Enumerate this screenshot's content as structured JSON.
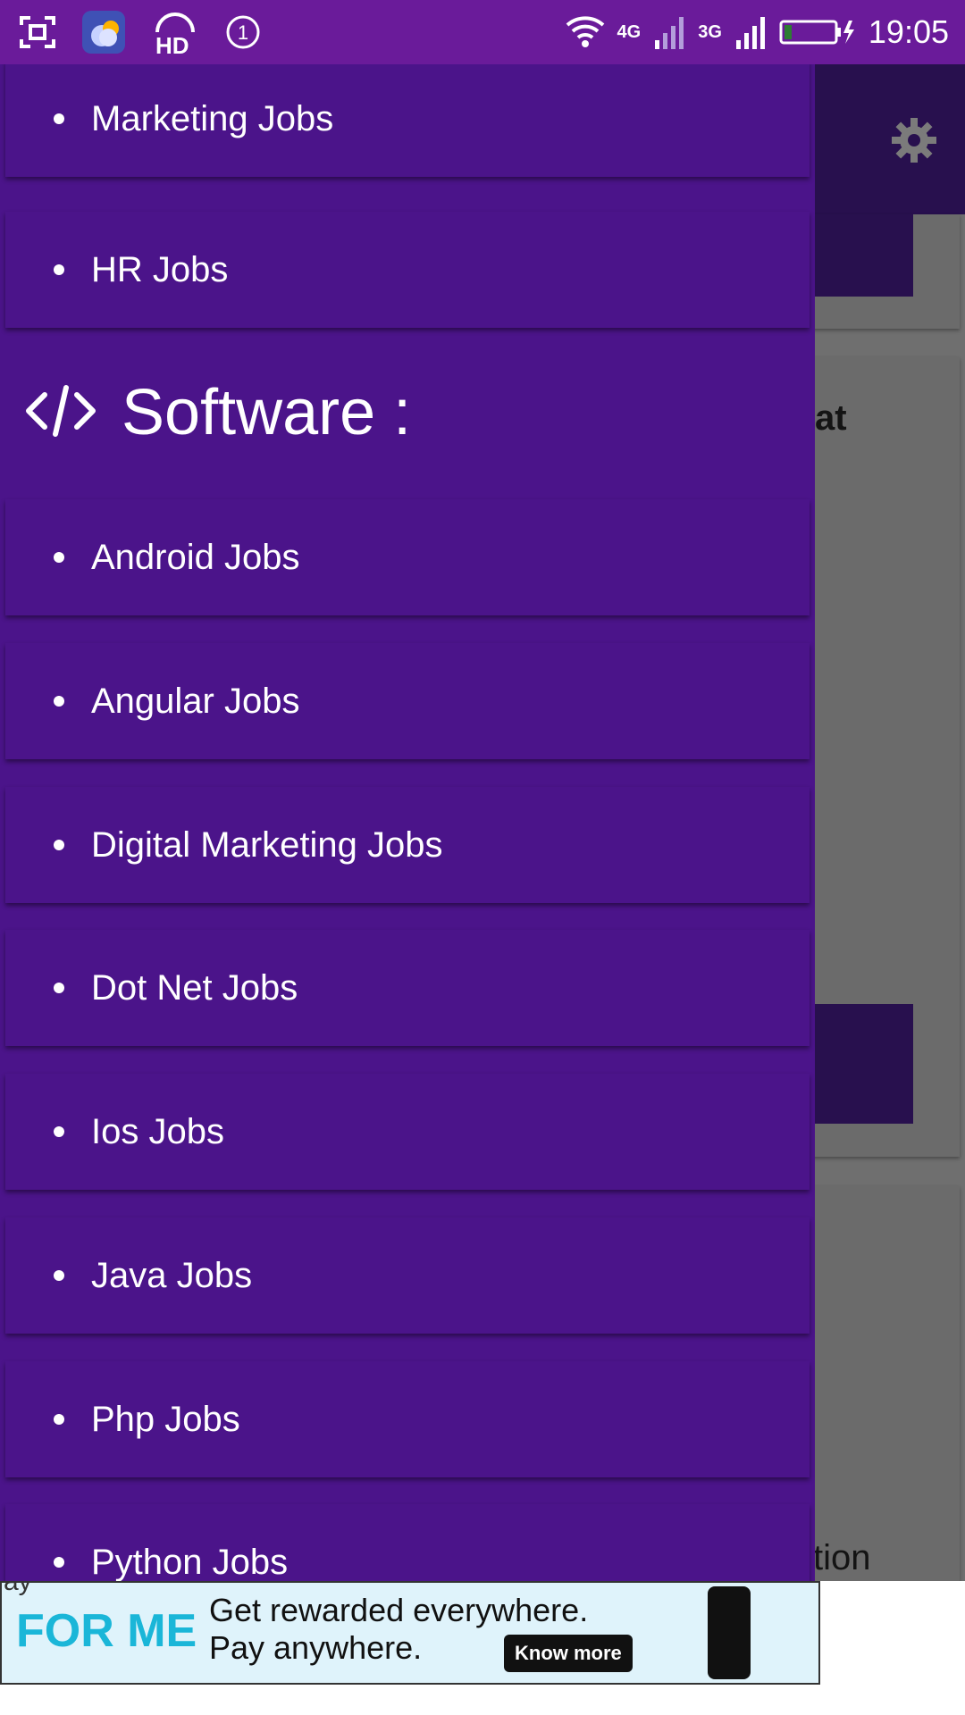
{
  "status_bar": {
    "notification_count": "1",
    "hd_label": "HD",
    "net_4g": "4G",
    "net_3g": "3G",
    "time": "19:05"
  },
  "background": {
    "partial_text_1": "at",
    "partial_text_2": "tion"
  },
  "drawer": {
    "top_items": [
      {
        "label": "Marketing Jobs"
      },
      {
        "label": "HR Jobs"
      }
    ],
    "section": {
      "icon": "code-icon",
      "title": "Software :"
    },
    "software_items": [
      {
        "label": "Android Jobs"
      },
      {
        "label": "Angular Jobs"
      },
      {
        "label": "Digital Marketing Jobs"
      },
      {
        "label": "Dot Net Jobs"
      },
      {
        "label": "Ios Jobs"
      },
      {
        "label": "Java Jobs"
      },
      {
        "label": "Php Jobs"
      },
      {
        "label": "Python Jobs"
      }
    ]
  },
  "ad": {
    "partial_top": "ay",
    "brand": "FOR ME",
    "line1": "Get rewarded everywhere.",
    "line2": "Pay anywhere.",
    "cta": "Know more"
  },
  "colors": {
    "status_bar": "#6a1b9a",
    "drawer": "#4b148a",
    "app_bar": "#28104e",
    "scrim": "#6f6f6f"
  }
}
